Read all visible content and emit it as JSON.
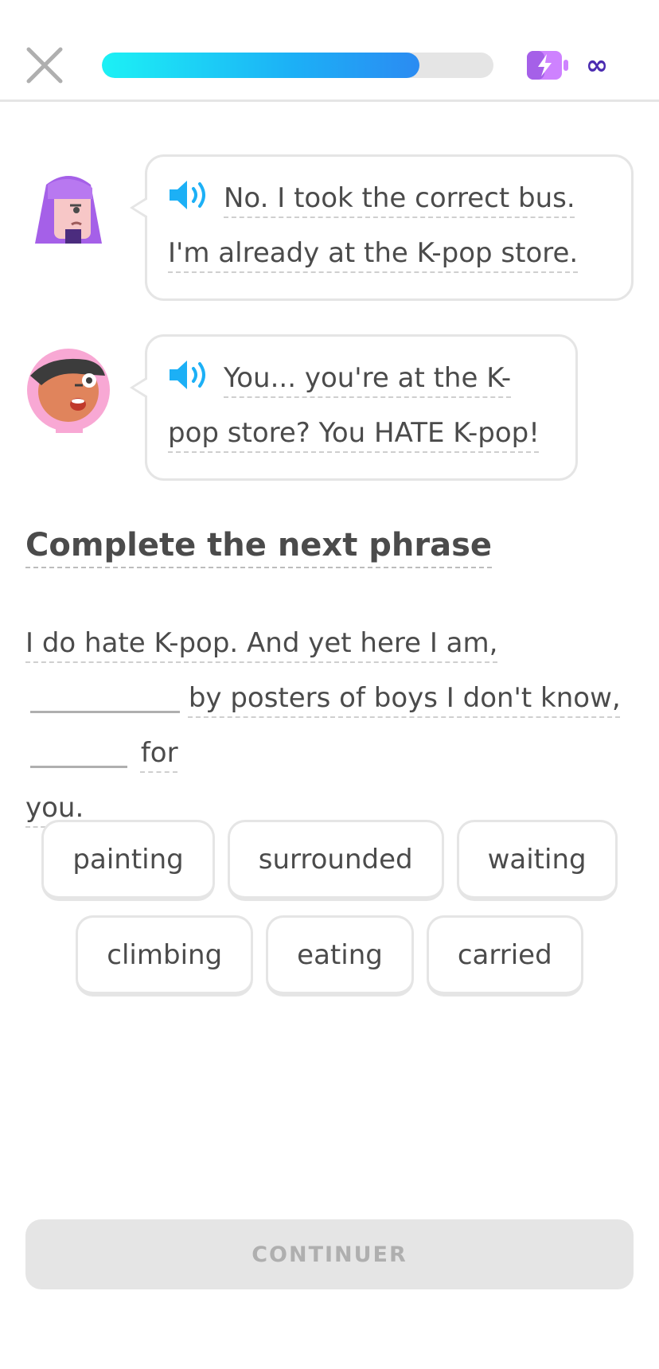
{
  "header": {
    "progress": 0.81,
    "energy_label": "∞",
    "colors": {
      "progress_start": "#1cf1f5",
      "progress_end": "#2b8bf2",
      "energy": "#ce82ff",
      "infinity": "#4a2bb0"
    }
  },
  "chat": {
    "messages": [
      {
        "speaker": "lily",
        "text": "No. I took the correct bus. I'm already at the K-pop store."
      },
      {
        "speaker": "junior",
        "text": "You... you're at the K-pop store? You HATE K-pop!"
      }
    ]
  },
  "exercise": {
    "instruction": "Complete the next phrase",
    "sentence": {
      "part1": "I do hate K-pop. And yet here I am,",
      "part2": "by posters of boys I don't know,",
      "part3": "for",
      "part4": "you."
    }
  },
  "word_bank": {
    "row1": [
      "painting",
      "surrounded",
      "waiting"
    ],
    "row2": [
      "climbing",
      "eating",
      "carried"
    ]
  },
  "footer": {
    "continue_label": "CONTINUER"
  }
}
